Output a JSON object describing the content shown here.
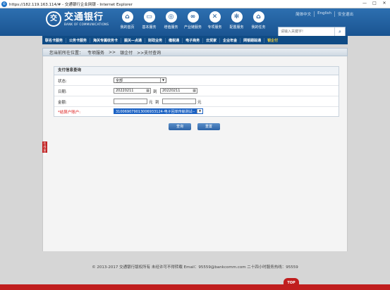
{
  "window": {
    "title": "https://182.119.163.114/# - 交通银行企业网银 - Internet Explorer"
  },
  "header": {
    "logo_cn": "交通银行",
    "logo_en": "BANK OF COMMUNICATIONS",
    "nav": [
      {
        "label": "我的首页",
        "icon": "home-icon",
        "glyph": "⌂"
      },
      {
        "label": "基本服务",
        "icon": "monitor-icon",
        "glyph": "▭"
      },
      {
        "label": "增值服务",
        "icon": "swirl-icon",
        "glyph": "◎"
      },
      {
        "label": "产业链服务",
        "icon": "link-icon",
        "glyph": "∞"
      },
      {
        "label": "专项服务",
        "icon": "tools-icon",
        "glyph": "✕"
      },
      {
        "label": "配置服务",
        "icon": "gear-icon",
        "glyph": "✻"
      },
      {
        "label": "我的任务",
        "icon": "home-task-icon",
        "glyph": "⌂"
      }
    ],
    "toplinks": [
      "简体中文",
      "English",
      "安全退出"
    ],
    "search_placeholder": "请输入关键字!"
  },
  "menu": [
    "联名卡服务",
    "公务卡服务",
    "海关专属收务卡",
    "掘关—点通",
    "财政业务",
    "缴税通",
    "电子商务",
    "云贸家",
    "企业年金",
    "网银跟踪通",
    "银企付"
  ],
  "breadcrumb": {
    "label": "您当前所在位置：",
    "path": [
      "专项服务",
      ">>",
      "银企付",
      ">>支付查询"
    ]
  },
  "form": {
    "title": "支付信息查询",
    "status_label": "状态:",
    "status_value": "全部",
    "date_label": "日期:",
    "date_from": "20220211",
    "date_to_sep": "到",
    "date_to": "20220211",
    "amount_label": "金额:",
    "amount_unit1": "元",
    "amount_to_sep": "到",
    "amount_unit2": "元",
    "account_label": "*结算户账户:",
    "account_value": "310069079013006933124-电子回单传输测试--"
  },
  "buttons": {
    "query": "查询",
    "reset": "重置"
  },
  "sidetab": "在线客服",
  "footer": "© 2013-2017 交通银行版权所有 未经许可不得转载 Email：95559@bankcomm.com 二十四小时服务热线：95559",
  "totop": "TOP"
}
